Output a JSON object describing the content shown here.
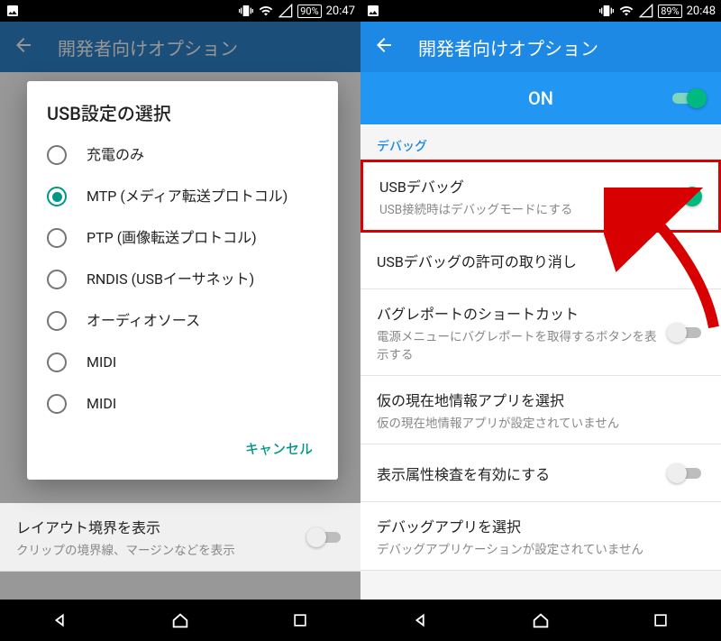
{
  "left": {
    "status": {
      "battery": "90%",
      "time": "20:47"
    },
    "header_title": "開発者向けオプション",
    "dialog": {
      "title": "USB設定の選択",
      "selected_index": 1,
      "options": [
        "充電のみ",
        "MTP (メディア転送プロトコル)",
        "PTP (画像転送プロトコル)",
        "RNDIS (USBイーサネット)",
        "オーディオソース",
        "MIDI",
        "MIDI"
      ],
      "cancel": "キャンセル"
    },
    "bg_rows": [
      {
        "primary": "レイアウト境界を表示",
        "secondary": "クリップの境界線、マージンなどを表示"
      }
    ]
  },
  "right": {
    "status": {
      "battery": "89%",
      "time": "20:48"
    },
    "header_title": "開発者向けオプション",
    "on_label": "ON",
    "section": "デバッグ",
    "rows": [
      {
        "primary": "USBデバッグ",
        "secondary": "USB接続時はデバッグモードにする",
        "toggle": "on",
        "highlight": true
      },
      {
        "primary": "USBデバッグの許可の取り消し",
        "secondary": ""
      },
      {
        "primary": "バグレポートのショートカット",
        "secondary": "電源メニューにバグレポートを取得するボタンを表示する",
        "toggle": "off"
      },
      {
        "primary": "仮の現在地情報アプリを選択",
        "secondary": "仮の現在地情報アプリが設定されていません"
      },
      {
        "primary": "表示属性検査を有効にする",
        "secondary": "",
        "toggle": "off"
      },
      {
        "primary": "デバッグアプリを選択",
        "secondary": "デバッグアプリケーションが設定されていません"
      }
    ]
  }
}
